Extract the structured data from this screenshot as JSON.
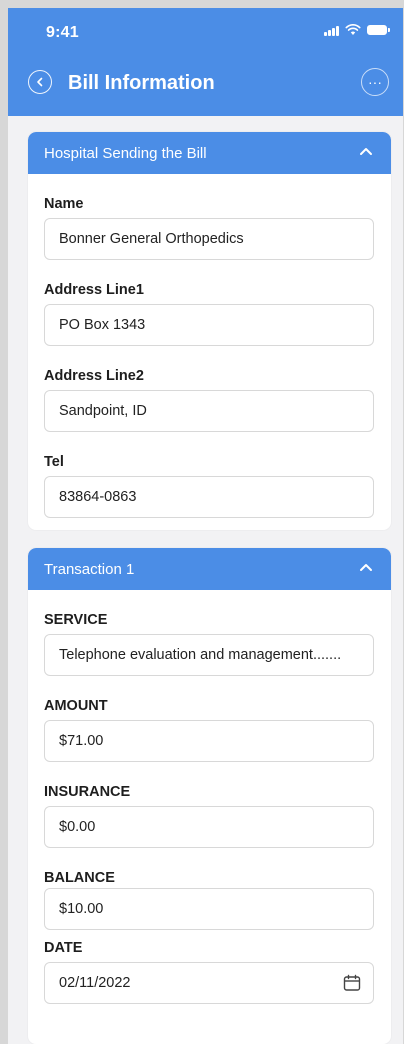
{
  "status_bar": {
    "time": "9:41"
  },
  "nav": {
    "title": "Bill Information",
    "more_label": "···"
  },
  "hospital": {
    "section_title": "Hospital Sending the Bill",
    "fields": [
      {
        "label": "Name",
        "value": "Bonner General Orthopedics"
      },
      {
        "label": "Address Line1",
        "value": "PO Box 1343"
      },
      {
        "label": "Address Line2",
        "value": "Sandpoint, ID"
      },
      {
        "label": "Tel",
        "value": "83864-0863"
      }
    ]
  },
  "transaction": {
    "section_title": "Transaction 1",
    "fields": [
      {
        "label": "SERVICE",
        "value": "Telephone evaluation and management......."
      },
      {
        "label": "AMOUNT",
        "value": "$71.00"
      },
      {
        "label": "INSURANCE",
        "value": "$0.00"
      },
      {
        "label": "BALANCE",
        "value": "$10.00"
      },
      {
        "label": "DATE",
        "value": "02/11/2022"
      }
    ]
  },
  "colors": {
    "accent": "#4b8de6",
    "background": "#f2f2f4"
  },
  "icons": {
    "back": "chevron-left-icon",
    "more": "more-horizontal-icon",
    "collapse": "chevron-up-icon",
    "date": "calendar-icon"
  }
}
